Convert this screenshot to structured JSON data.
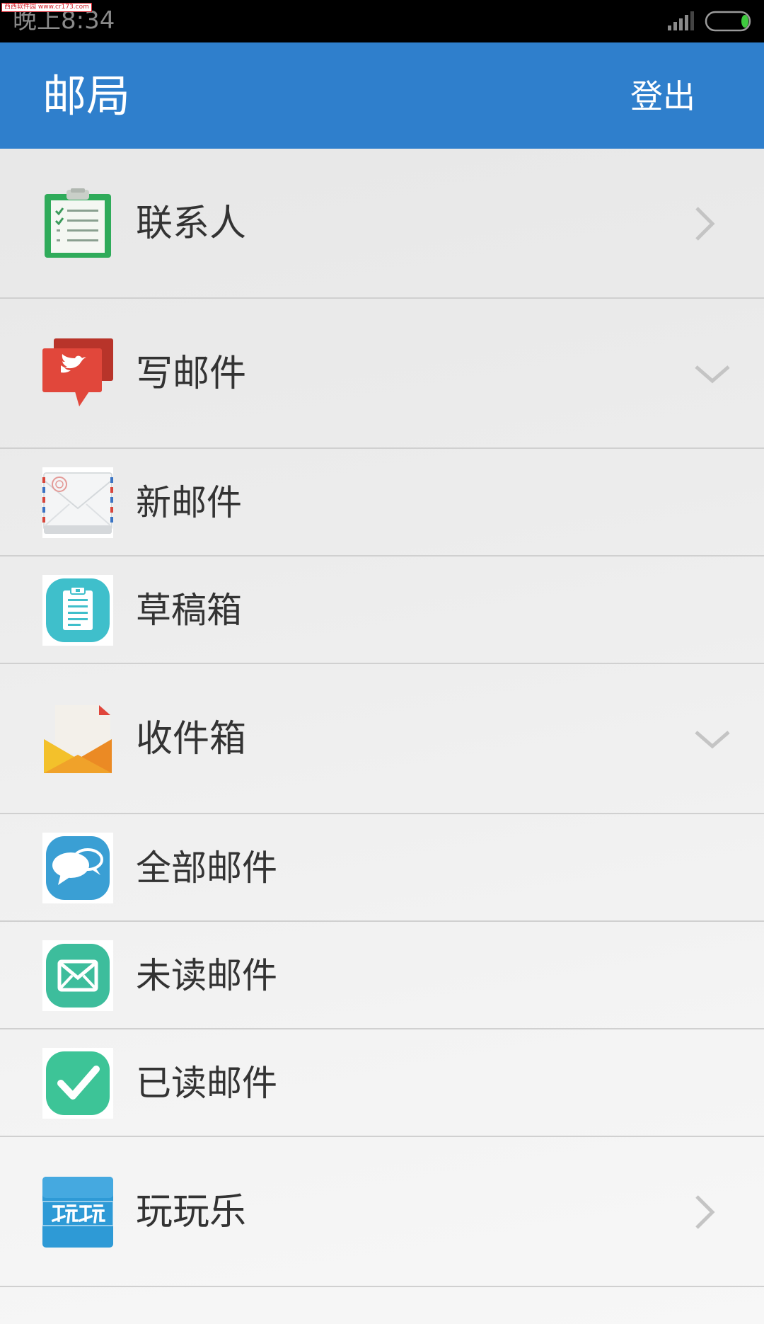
{
  "status_bar": {
    "time": "晚上8:34",
    "watermark": "西西软件园 www.cr173.com"
  },
  "app_bar": {
    "title": "邮局",
    "logout_label": "登出"
  },
  "menu": {
    "contacts": {
      "label": "联系人",
      "icon": "clipboard-list-icon",
      "indicator": "chevron-right"
    },
    "compose": {
      "label": "写邮件",
      "icon": "speech-bubble-icon",
      "indicator": "chevron-down"
    },
    "new_mail": {
      "label": "新邮件",
      "icon": "airmail-envelope-icon"
    },
    "drafts": {
      "label": "草稿箱",
      "icon": "notepad-icon"
    },
    "inbox": {
      "label": "收件箱",
      "icon": "open-envelope-icon",
      "indicator": "chevron-down"
    },
    "all_mail": {
      "label": "全部邮件",
      "icon": "chat-bubbles-icon"
    },
    "unread": {
      "label": "未读邮件",
      "icon": "envelope-icon"
    },
    "read": {
      "label": "已读邮件",
      "icon": "checkmark-icon"
    },
    "fun": {
      "label": "玩玩乐",
      "icon": "play-logo-icon",
      "indicator": "chevron-right"
    }
  },
  "colors": {
    "app_bar": "#2f7fcc",
    "status_bar": "#000000",
    "text": "#333333",
    "divider": "#d0d0d0",
    "battery": "#3fc93f"
  }
}
